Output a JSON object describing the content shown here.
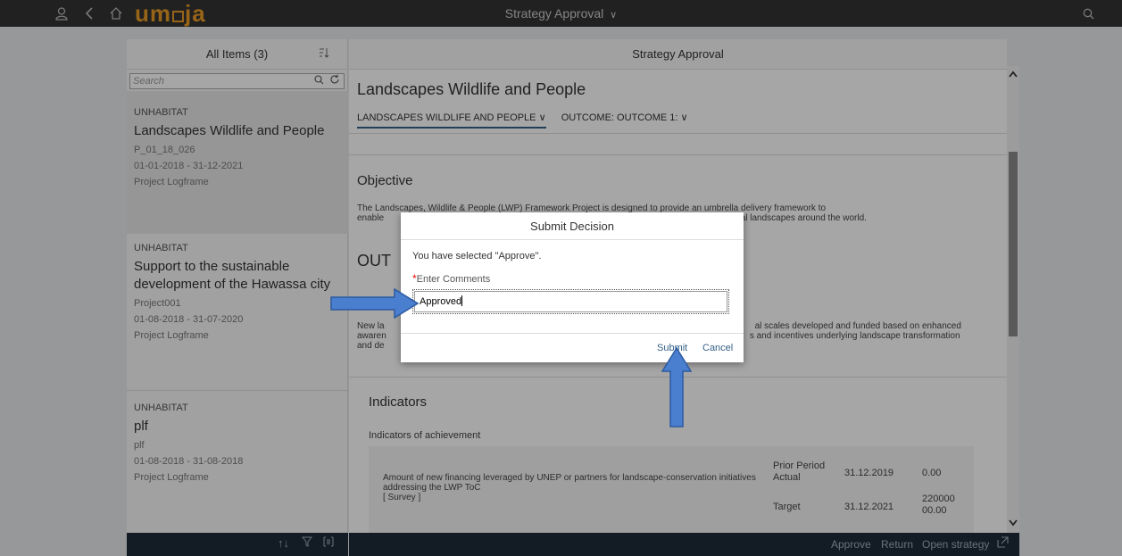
{
  "shell": {
    "logo_pre": "um",
    "logo_post": "ja",
    "title": "Strategy Approval",
    "title_chevron": "∨"
  },
  "master": {
    "header": "All Items (3)",
    "search_placeholder": "Search",
    "items": [
      {
        "org": "UNHABITAT",
        "title": "Landscapes Wildlife and People",
        "code": "P_01_18_026",
        "dates": "01-01-2018 - 31-12-2021",
        "type": "Project Logframe"
      },
      {
        "org": "UNHABITAT",
        "title": "Support to the sustainable development of the Hawassa city",
        "code": "Project001",
        "dates": "01-08-2018 - 31-07-2020",
        "type": "Project Logframe"
      },
      {
        "org": "UNHABITAT",
        "title": "plf",
        "code": "plf",
        "dates": "01-08-2018 - 31-08-2018",
        "type": "Project Logframe"
      }
    ]
  },
  "detail": {
    "header": "Strategy Approval",
    "title": "Landscapes Wildlife and People",
    "tabs": [
      "LANDSCAPES WILDLIFE AND PEOPLE ∨",
      "OUTCOME: OUTCOME 1: ∨"
    ],
    "objective_heading": "Objective",
    "objective_text_1a": "The Landscapes, Wildlife & People (LWP) Framework Project is designed to provide an umbrella delivery framework to",
    "objective_text_2a": "enable",
    "objective_text_2b": "tural landscapes around the world.",
    "outcome_heading": "OUT",
    "outcome_text_1a": "New la",
    "outcome_text_1b": "al scales developed and funded based on enhanced",
    "outcome_text_2a": "awaren",
    "outcome_text_2b": "s and incentives underlying landscape transformation",
    "outcome_text_3a": "and de",
    "indicators_heading": "Indicators",
    "indicators_sub": "Indicators of achievement",
    "indicator_desc": "Amount of new financing leveraged by UNEP or partners for landscape-conservation initiatives addressing the LWP ToC",
    "indicator_source": "[ Survey ]",
    "rows": [
      {
        "label": "Prior Period Actual",
        "date": "31.12.2019",
        "value": "0.00"
      },
      {
        "label": "Target",
        "date": "31.12.2021",
        "value": "220000 00.00"
      }
    ]
  },
  "footer": {
    "approve": "Approve",
    "return": "Return",
    "open_strategy": "Open strategy"
  },
  "dialog": {
    "title": "Submit Decision",
    "message": "You have selected \"Approve\".",
    "required_mark": "*",
    "comments_label": "Enter Comments",
    "comments_value": "Approved",
    "submit": "Submit",
    "cancel": "Cancel"
  },
  "colors": {
    "arrow": "#4a7ecf",
    "logo": "#e89a26",
    "footer_bg": "#1e2b38",
    "link": "#346187"
  }
}
